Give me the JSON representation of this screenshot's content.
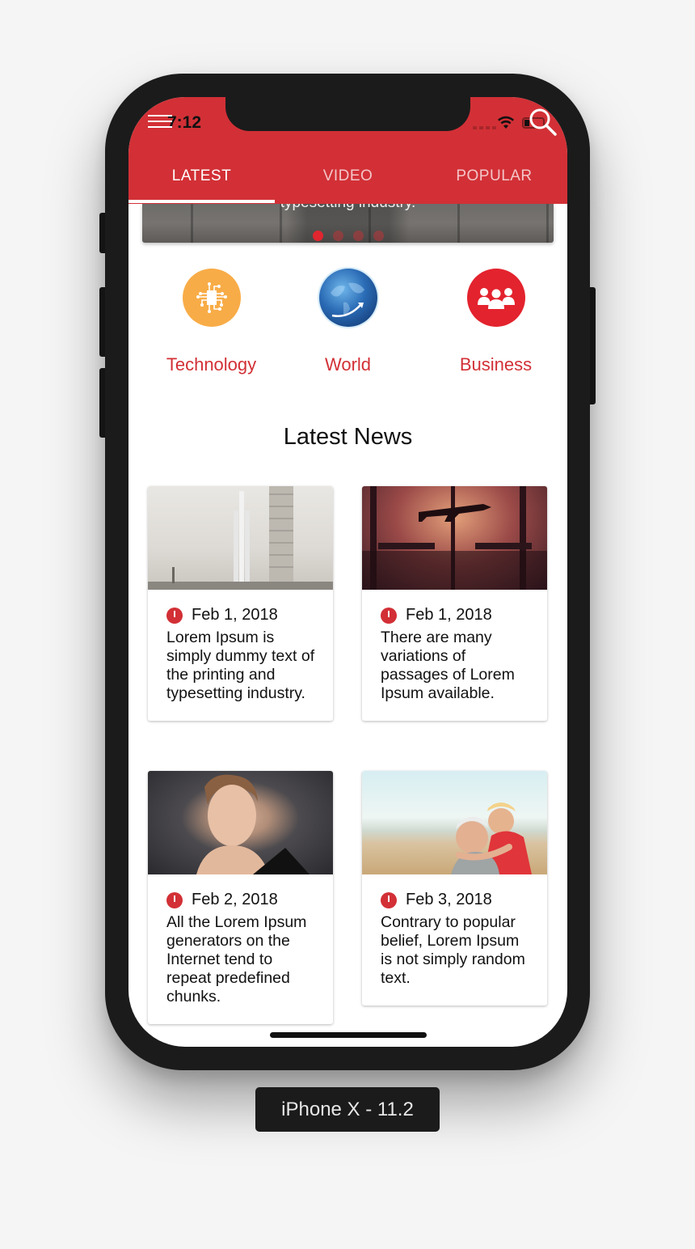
{
  "status_bar": {
    "time": "7:12"
  },
  "app_bar": {
    "menu_icon": "hamburger-icon",
    "search_icon": "search-icon",
    "tabs": [
      {
        "label": "LATEST",
        "active": true
      },
      {
        "label": "VIDEO",
        "active": false
      },
      {
        "label": "POPULAR",
        "active": false
      }
    ]
  },
  "carousel": {
    "caption": "typesetting industry.",
    "slide_count": 4,
    "active_slide": 1
  },
  "categories": [
    {
      "label": "Technology",
      "icon": "chip-icon",
      "color": "#f8ac47"
    },
    {
      "label": "World",
      "icon": "globe-icon",
      "color": "#1c4f93"
    },
    {
      "label": "Business",
      "icon": "people-icon",
      "color": "#e3232e"
    }
  ],
  "latest_news": {
    "title": "Latest News",
    "articles": [
      {
        "date": "Feb 1, 2018",
        "text": "Lorem Ipsum is simply dummy text of the printing and typesetting industry.",
        "image": "rocket-launch-photo"
      },
      {
        "date": "Feb 1, 2018",
        "text": "There are many variations of passages of Lorem Ipsum available.",
        "image": "airport-airplane-photo"
      },
      {
        "date": "Feb 2, 2018",
        "text": "All the Lorem Ipsum generators on the Internet tend to repeat predefined chunks.",
        "image": "woman-portrait-photo"
      },
      {
        "date": "Feb 3, 2018",
        "text": "Contrary to popular belief, Lorem Ipsum is not simply random text.",
        "image": "couple-beach-photo"
      }
    ]
  },
  "device_label": "iPhone X - 11.2",
  "colors": {
    "primary": "#d23036",
    "frame": "#1b1b1b"
  }
}
